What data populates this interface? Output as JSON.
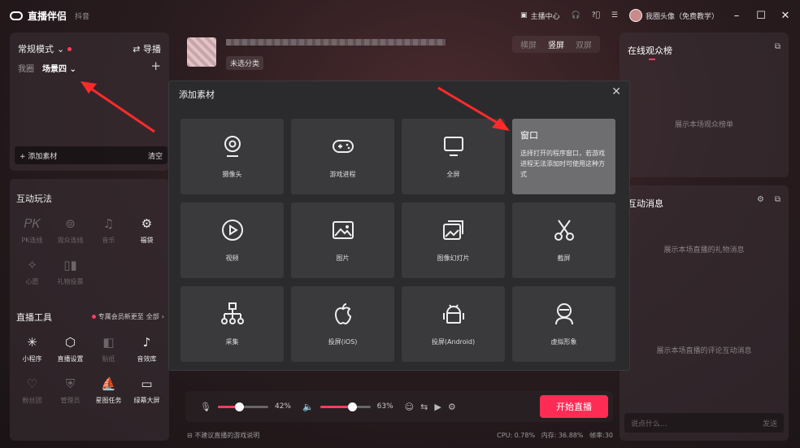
{
  "app": {
    "name": "直播伴侣",
    "platform": "抖音"
  },
  "titlebar": {
    "host_center": "主播中心",
    "user_name": "我圈头像（免费教学）"
  },
  "left_top": {
    "mode": "常规模式",
    "guide": "导播",
    "scenes": [
      "我圈",
      "场景四"
    ],
    "add_material": "添加素材",
    "clear": "清空"
  },
  "interactive": {
    "title": "互动玩法",
    "items": [
      {
        "label": "PK连线",
        "icon": "pk-icon",
        "dim": true
      },
      {
        "label": "观众连线",
        "icon": "audience-link-icon",
        "dim": true
      },
      {
        "label": "音乐",
        "icon": "music-icon",
        "dim": true
      },
      {
        "label": "福袋",
        "icon": "lucky-bag-icon",
        "dim": false
      },
      {
        "label": "心愿",
        "icon": "wish-icon",
        "dim": true
      },
      {
        "label": "礼物投票",
        "icon": "gift-vote-icon",
        "dim": true
      }
    ]
  },
  "tools": {
    "title": "直播工具",
    "vip_note": "专属会员新更至",
    "all": "全部",
    "items": [
      {
        "label": "小程序",
        "icon": "mini-program-icon",
        "dim": false
      },
      {
        "label": "直播设置",
        "icon": "live-settings-icon",
        "dim": false
      },
      {
        "label": "贴纸",
        "icon": "sticker-icon",
        "dim": true
      },
      {
        "label": "音效库",
        "icon": "sound-effects-icon",
        "dim": false
      },
      {
        "label": "粉丝团",
        "icon": "fan-club-icon",
        "dim": true
      },
      {
        "label": "管理员",
        "icon": "admin-icon",
        "dim": true
      },
      {
        "label": "星图任务",
        "icon": "star-task-icon",
        "dim": false
      },
      {
        "label": "绿幕大屏",
        "icon": "green-screen-icon",
        "dim": false
      }
    ]
  },
  "stream": {
    "category": "未选分类",
    "orientation": [
      "横屏",
      "竖屏",
      "双屏"
    ],
    "active_orientation": "竖屏"
  },
  "right": {
    "audience_title": "在线观众榜",
    "audience_hint": "展示本场观众榜单",
    "interaction_title": "互动消息",
    "gift_hint": "展示本场直播的礼物消息",
    "comment_hint": "展示本场直播的评论互动消息",
    "comment_placeholder": "说点什么...",
    "send": "发送"
  },
  "bottom": {
    "mic_volume": 42,
    "mic_volume_label": "42%",
    "speaker_volume": 63,
    "speaker_volume_label": "63%",
    "start_live": "开始直播",
    "notice": "不建议直播的游戏说明",
    "cpu": "CPU: 0.78%",
    "memory": "内存: 36.88%",
    "fps": "帧率:30"
  },
  "modal": {
    "title": "添加素材",
    "tiles": [
      {
        "label": "摄像头",
        "icon": "camera-icon"
      },
      {
        "label": "游戏进程",
        "icon": "gamepad-icon"
      },
      {
        "label": "全屏",
        "icon": "monitor-icon"
      },
      {
        "label": "窗口",
        "icon": "window-icon",
        "hover": true,
        "desc": "选择打开的程序窗口，若游戏进程无法添加时可使用这种方式"
      },
      {
        "label": "视频",
        "icon": "play-icon"
      },
      {
        "label": "图片",
        "icon": "image-icon"
      },
      {
        "label": "图像幻灯片",
        "icon": "slideshow-icon"
      },
      {
        "label": "截屏",
        "icon": "scissors-icon"
      },
      {
        "label": "采集",
        "icon": "capture-icon"
      },
      {
        "label": "投屏(iOS)",
        "icon": "apple-icon"
      },
      {
        "label": "投屏(Android)",
        "icon": "android-icon"
      },
      {
        "label": "虚拟形象",
        "icon": "avatar-icon"
      }
    ]
  },
  "colors": {
    "accent": "#fe2c55",
    "modal_bg": "#2b2b2d",
    "tile_bg": "#3a3a3c"
  }
}
